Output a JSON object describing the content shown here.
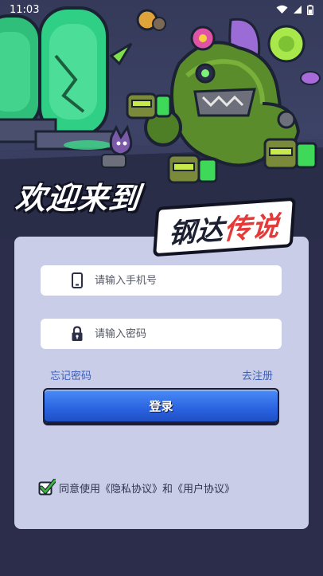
{
  "status_bar": {
    "time": "11:03",
    "icons": [
      "wifi-icon",
      "signal-icon",
      "battery-icon"
    ]
  },
  "hero": {
    "welcome_text": "欢迎来到",
    "logo_text_a": "钢达",
    "logo_text_b": "传说"
  },
  "login_form": {
    "phone": {
      "placeholder": "请输入手机号",
      "value": "",
      "icon": "phone-icon"
    },
    "password": {
      "placeholder": "请输入密码",
      "value": "",
      "icon": "lock-icon"
    },
    "forgot_password_label": "忘记密码",
    "register_label": "去注册",
    "login_button_label": "登录",
    "agreement": {
      "checked": true,
      "text": "同意使用《隐私协议》和《用户协议》"
    }
  },
  "colors": {
    "background": "#2b2d4a",
    "card": "#c9cde8",
    "link": "#3d5fb8",
    "button": "#2a63e0",
    "logo_accent": "#e43a3a",
    "checkbox": "#3fb43f"
  }
}
